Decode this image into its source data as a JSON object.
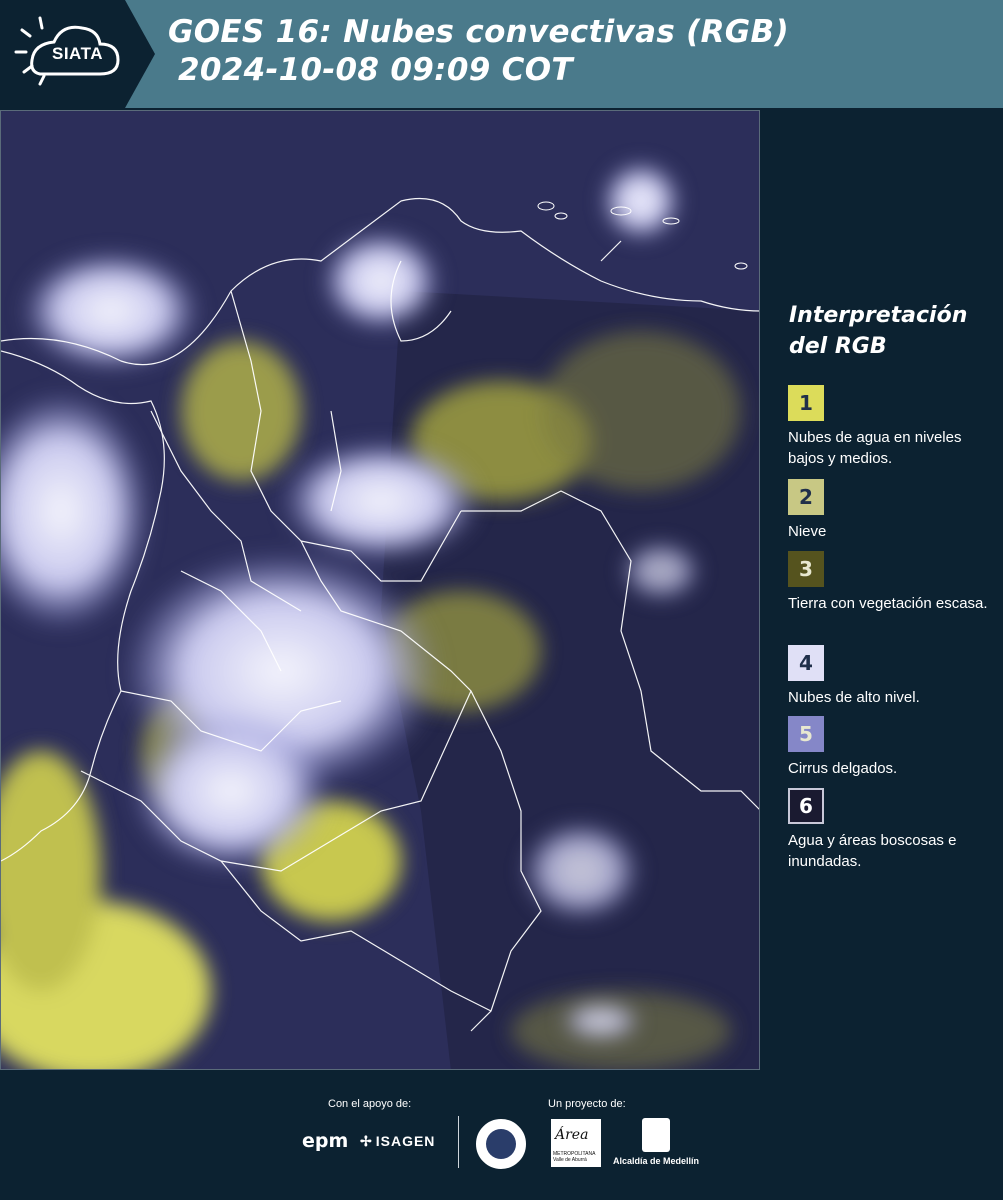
{
  "header": {
    "logo_text": "SIATA",
    "title_line1": "GOES 16: Nubes convectivas (RGB)",
    "title_line2": "2024-10-08 09:09 COT"
  },
  "map": {
    "colors": {
      "background": "#2c2e5a",
      "low_clouds": "#d8d860",
      "high_clouds": "#e6e6f6",
      "borders": "#ffffff"
    }
  },
  "legend": {
    "title": "Interpretación del RGB",
    "items": [
      {
        "number": "1",
        "color": "#dcdc5a",
        "label": "Nubes de agua en niveles bajos y medios."
      },
      {
        "number": "2",
        "color": "#c8c884",
        "label": "Nieve"
      },
      {
        "number": "3",
        "color": "#55531e",
        "label": "Tierra con vegetación escasa."
      },
      {
        "number": "4",
        "color": "#e0e0f6",
        "label": "Nubes de alto nivel."
      },
      {
        "number": "5",
        "color": "#8587c8",
        "label": "Cirrus delgados."
      },
      {
        "number": "6",
        "color": "#1a1a30",
        "label": "Agua y áreas boscosas e inundadas."
      }
    ]
  },
  "footer": {
    "support_label": "Con el apoyo de:",
    "project_label": "Un proyecto de:",
    "epm": "epm",
    "isagen": "ISAGEN",
    "area_text": "Área",
    "area_sub": "METROPOLITANA Valle de Aburrá",
    "alcaldia": "Alcaldía de Medellín"
  }
}
